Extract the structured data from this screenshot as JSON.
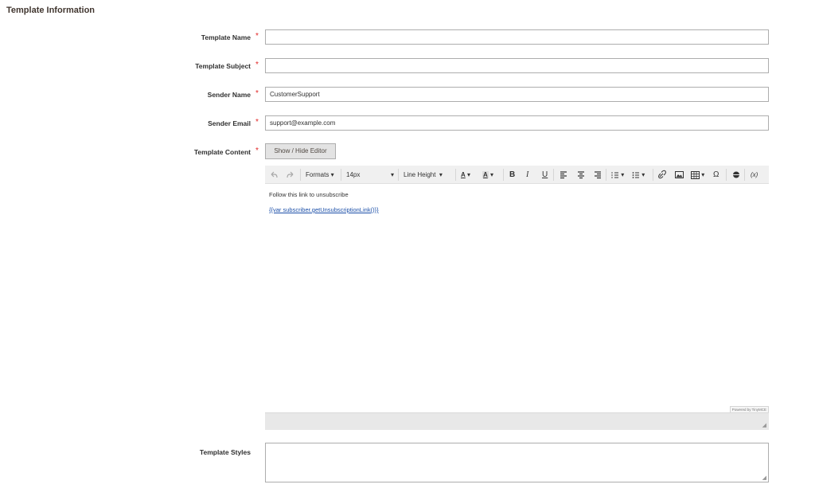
{
  "section": {
    "title": "Template Information"
  },
  "fields": {
    "template_name": {
      "label": "Template Name",
      "required": "*",
      "value": ""
    },
    "template_subject": {
      "label": "Template Subject",
      "required": "*",
      "value": ""
    },
    "sender_name": {
      "label": "Sender Name",
      "required": "*",
      "value": "CustomerSupport"
    },
    "sender_email": {
      "label": "Sender Email",
      "required": "*",
      "value": "support@example.com"
    },
    "template_content": {
      "label": "Template Content",
      "required": "*"
    },
    "template_styles": {
      "label": "Template Styles",
      "value": ""
    }
  },
  "editor": {
    "toggle_label": "Show / Hide Editor",
    "toolbar": {
      "formats": "Formats",
      "font_size": "14px",
      "line_height": "Line Height",
      "bold": "B",
      "italic": "I",
      "underline": "U",
      "special_char": "Ω",
      "variable": "(x)"
    },
    "content": {
      "line1": "Follow this link to unsubscribe",
      "line2": "{{var subscriber.getUnsubscriptionLink()}}"
    },
    "powered_by": "Powered by TinyMCE"
  }
}
